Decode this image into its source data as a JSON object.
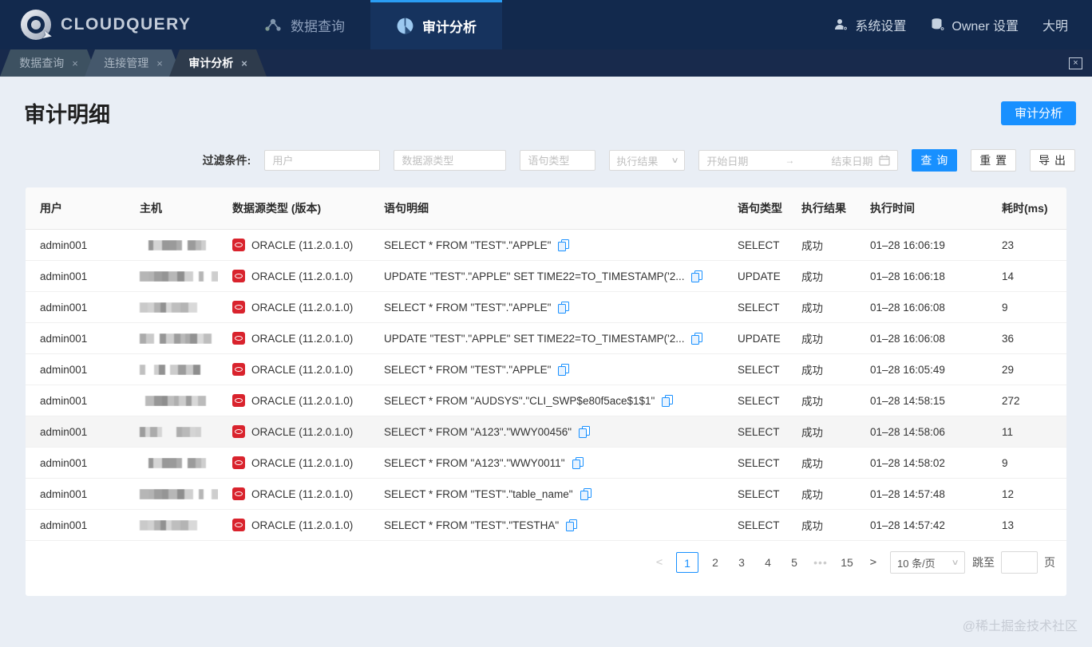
{
  "colors": {
    "accent": "#1890ff",
    "navbar": "#12294d",
    "oracle_red": "#d9232d",
    "page_bg": "#e9eef5"
  },
  "app": {
    "logo_text": "CLOUDQUERY",
    "nav": [
      {
        "label": "数据查询",
        "active": false
      },
      {
        "label": "审计分析",
        "active": true
      }
    ],
    "user_menu": {
      "system_settings": "系统设置",
      "owner_settings": "Owner 设置",
      "username": "大明"
    }
  },
  "tabstrip": {
    "tabs": [
      {
        "label": "数据查询",
        "close": "×",
        "active": false
      },
      {
        "label": "连接管理",
        "close": "×",
        "active": false
      },
      {
        "label": "审计分析",
        "close": "×",
        "active": true
      }
    ]
  },
  "page": {
    "title": "审计明细",
    "action_button": "审计分析",
    "filter": {
      "label": "过滤条件:",
      "user_placeholder": "用户",
      "datasource_placeholder": "数据源类型",
      "statement_placeholder": "语句类型",
      "result_placeholder": "执行结果",
      "start_placeholder": "开始日期",
      "end_placeholder": "结束日期",
      "range_arrow": "→",
      "query_button": "查 询",
      "reset_button": "重 置",
      "export_button": "导 出"
    },
    "table": {
      "headers": [
        "用户",
        "主机",
        "数据源类型 (版本)",
        "语句明细",
        "语句类型",
        "执行结果",
        "执行时间",
        "耗时(ms)"
      ],
      "rows": [
        {
          "user": "admin001",
          "host_masked": true,
          "mask_seed": 3,
          "mask_width": 78,
          "datasource": "ORACLE (11.2.0.1.0)",
          "sql": "SELECT * FROM \"TEST\".\"APPLE\"",
          "type": "SELECT",
          "result": "成功",
          "time": "01–28 16:06:19",
          "cost": "23",
          "highlight": false
        },
        {
          "user": "admin001",
          "host_masked": true,
          "mask_seed": 7,
          "mask_width": 96,
          "datasource": "ORACLE (11.2.0.1.0)",
          "sql": "UPDATE \"TEST\".\"APPLE\" SET TIME22=TO_TIMESTAMP('2...",
          "type": "UPDATE",
          "result": "成功",
          "time": "01–28 16:06:18",
          "cost": "14",
          "highlight": false
        },
        {
          "user": "admin001",
          "host_masked": true,
          "mask_seed": 11,
          "mask_width": 70,
          "datasource": "ORACLE (11.2.0.1.0)",
          "sql": "SELECT * FROM \"TEST\".\"APPLE\"",
          "type": "SELECT",
          "result": "成功",
          "time": "01–28 16:06:08",
          "cost": "9",
          "highlight": false
        },
        {
          "user": "admin001",
          "host_masked": true,
          "mask_seed": 5,
          "mask_width": 88,
          "datasource": "ORACLE (11.2.0.1.0)",
          "sql": "UPDATE \"TEST\".\"APPLE\" SET TIME22=TO_TIMESTAMP('2...",
          "type": "UPDATE",
          "result": "成功",
          "time": "01–28 16:06:08",
          "cost": "36",
          "highlight": false
        },
        {
          "user": "admin001",
          "host_masked": true,
          "mask_seed": 9,
          "mask_width": 72,
          "datasource": "ORACLE (11.2.0.1.0)",
          "sql": "SELECT * FROM \"TEST\".\"APPLE\"",
          "type": "SELECT",
          "result": "成功",
          "time": "01–28 16:05:49",
          "cost": "29",
          "highlight": false
        },
        {
          "user": "admin001",
          "host_masked": true,
          "mask_seed": 13,
          "mask_width": 82,
          "datasource": "ORACLE (11.2.0.1.0)",
          "sql": "SELECT * FROM \"AUDSYS\".\"CLI_SWP$e80f5ace$1$1\"",
          "type": "SELECT",
          "result": "成功",
          "time": "01–28 14:58:15",
          "cost": "272",
          "highlight": false
        },
        {
          "user": "admin001",
          "host_masked": true,
          "mask_seed": 17,
          "mask_width": 76,
          "datasource": "ORACLE (11.2.0.1.0)",
          "sql": "SELECT * FROM \"A123\".\"WWY00456\"",
          "type": "SELECT",
          "result": "成功",
          "time": "01–28 14:58:06",
          "cost": "11",
          "highlight": true
        },
        {
          "user": "admin001",
          "host_masked": true,
          "mask_seed": 3,
          "mask_width": 78,
          "datasource": "ORACLE (11.2.0.1.0)",
          "sql": "SELECT * FROM \"A123\".\"WWY0011\"",
          "type": "SELECT",
          "result": "成功",
          "time": "01–28 14:58:02",
          "cost": "9",
          "highlight": false
        },
        {
          "user": "admin001",
          "host_masked": true,
          "mask_seed": 7,
          "mask_width": 96,
          "datasource": "ORACLE (11.2.0.1.0)",
          "sql": "SELECT * FROM \"TEST\".\"table_name\"",
          "type": "SELECT",
          "result": "成功",
          "time": "01–28 14:57:48",
          "cost": "12",
          "highlight": false
        },
        {
          "user": "admin001",
          "host_masked": true,
          "mask_seed": 11,
          "mask_width": 62,
          "datasource": "ORACLE (11.2.0.1.0)",
          "sql": "SELECT * FROM \"TEST\".\"TESTHA\"",
          "type": "SELECT",
          "result": "成功",
          "time": "01–28 14:57:42",
          "cost": "13",
          "highlight": false
        }
      ]
    },
    "pagination": {
      "prev": "<",
      "next": ">",
      "pages": [
        "1",
        "2",
        "3",
        "4",
        "5",
        "•••",
        "15"
      ],
      "active_page": "1",
      "page_size": "10 条/页",
      "jump_label": "跳至",
      "jump_suffix": "页"
    }
  },
  "watermark": "@稀土掘金技术社区"
}
